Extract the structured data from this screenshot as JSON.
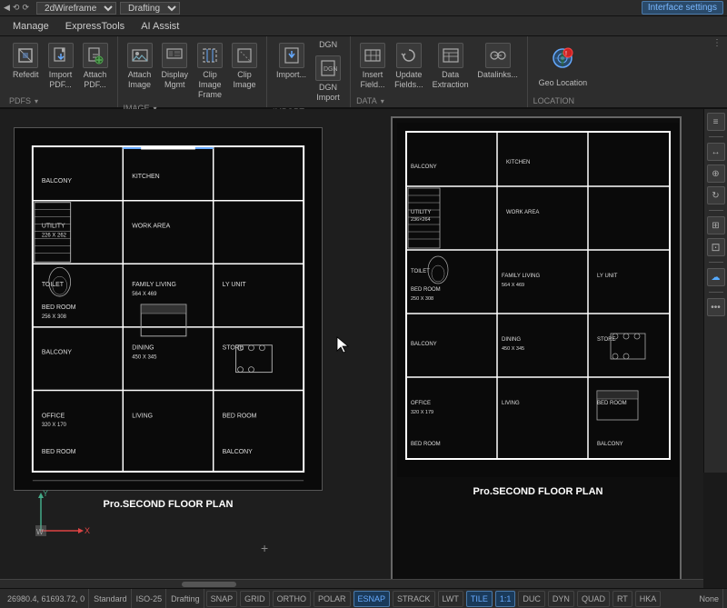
{
  "topbar": {
    "icons": [
      "◀",
      "◀▶",
      "▶",
      "⟲",
      "⟳",
      "□"
    ],
    "view_mode": "2dWireframe",
    "workspace": "Drafting",
    "interface_settings": "Interface settings"
  },
  "menubar": {
    "items": [
      "Manage",
      "ExpressTools",
      "AI Assist"
    ]
  },
  "ribbon": {
    "groups": [
      {
        "label": "PDFS",
        "buttons": [
          {
            "label": "Refedit",
            "icon": "✏"
          },
          {
            "label": "Import\nPDF...",
            "icon": "📥"
          },
          {
            "label": "Attach\nPDF...",
            "icon": "📎"
          }
        ]
      },
      {
        "label": "IMAGE",
        "buttons": [
          {
            "label": "Attach\nImage",
            "icon": "🖼"
          },
          {
            "label": "Display\nManagement",
            "icon": "📊"
          },
          {
            "label": "Clip\nImage\nFrame",
            "icon": "✂"
          },
          {
            "label": "Clip\nImage",
            "icon": "🔲"
          }
        ]
      },
      {
        "label": "IMPORT",
        "buttons": [
          {
            "label": "Import...",
            "icon": "⬆"
          },
          {
            "label": "DGN\nImport",
            "icon": "📄"
          }
        ]
      },
      {
        "label": "DATA",
        "buttons": [
          {
            "label": "Insert\nField...",
            "icon": "▦"
          },
          {
            "label": "Update\nFields...",
            "icon": "🔄"
          },
          {
            "label": "Data\nExtraction",
            "icon": "📋"
          },
          {
            "label": "Datalinks...",
            "icon": "🔗"
          }
        ]
      },
      {
        "label": "LOCATION",
        "buttons": [
          {
            "label": "Geo\nLocation",
            "icon": "🌍"
          }
        ]
      }
    ]
  },
  "rightToolbar": {
    "buttons": [
      "≡",
      "☰",
      "↔",
      "✦",
      "☁",
      "⊞",
      "◯",
      "⬡"
    ]
  },
  "floorPlans": {
    "left": {
      "title": "Pro.SECOND  FLOOR PLAN",
      "id": "plan-left"
    },
    "right": {
      "title": "Pro.SECOND  FLOOR PLAN",
      "id": "plan-right"
    }
  },
  "statusBar": {
    "coordinates": "26980.4, 61693.72, 0",
    "standard": "Standard",
    "lineType": "ISO-25",
    "workspace": "Drafting",
    "buttons": [
      "SNAP",
      "GRID",
      "ORTHO",
      "POLAR",
      "ESNAP",
      "STRACK",
      "LWT",
      "TILE",
      "1:1",
      "DUC",
      "DYN",
      "QUAD",
      "RT",
      "HKA"
    ],
    "active_buttons": [
      "ESNAP",
      "TILE",
      "1:1"
    ],
    "end_label": "None"
  }
}
